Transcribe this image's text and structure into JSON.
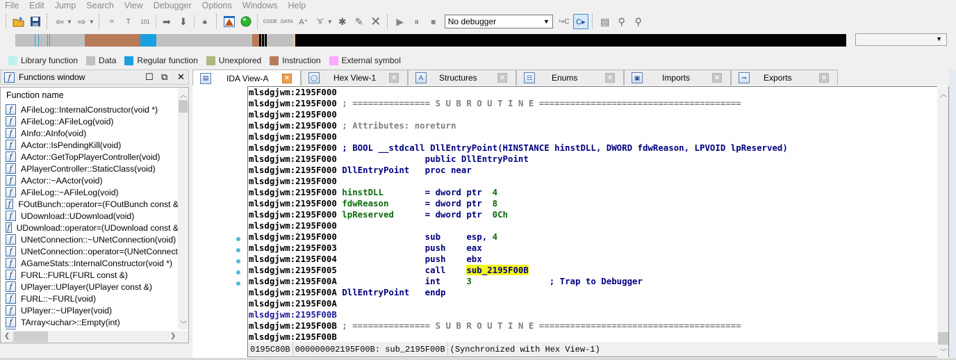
{
  "menubar": [
    "File",
    "Edit",
    "Jump",
    "Search",
    "View",
    "Debugger",
    "Options",
    "Windows",
    "Help"
  ],
  "toolbar": {
    "debugger_select": "No debugger",
    "icons": [
      "open-file-icon",
      "save-icon",
      "back-icon",
      "forward-icon",
      "search-binary-icon",
      "search-text-icon",
      "search-immediate-icon",
      "search-next-icon",
      "jump-icon",
      "lock-icon",
      "warning-icon",
      "green-ball-icon",
      "make-code-icon",
      "make-data-icon",
      "make-string-icon",
      "make-struct-icon",
      "make-function-icon",
      "edit-icon",
      "undefine-icon",
      "start-process-icon",
      "pause-icon",
      "stop-icon",
      "step-into-icon",
      "run-to-cursor-icon",
      "properties-icon",
      "add-breakpoint-icon",
      "remove-breakpoint-icon"
    ]
  },
  "navband": {
    "segments": [
      {
        "color": "#c0c0c0",
        "w": 28
      },
      {
        "color": "#3aa3d6",
        "w": 1
      },
      {
        "color": "#c0c0c0",
        "w": 4
      },
      {
        "color": "#3aa3d6",
        "w": 1
      },
      {
        "color": "#c0c0c0",
        "w": 12
      },
      {
        "color": "#b87b5a",
        "w": 1
      },
      {
        "color": "#c0c0c0",
        "w": 2
      },
      {
        "color": "#3aa3d6",
        "w": 1
      },
      {
        "color": "#c0c0c0",
        "w": 50
      },
      {
        "color": "#b87b5a",
        "w": 80
      },
      {
        "color": "#1aa0e0",
        "w": 23
      },
      {
        "color": "#c0c0c0",
        "w": 138
      },
      {
        "color": "#b87b5a",
        "w": 10
      },
      {
        "color": "#000000",
        "w": 3
      },
      {
        "color": "#c0c0c0",
        "w": 1
      },
      {
        "color": "#000000",
        "w": 3
      },
      {
        "color": "#c0c0c0",
        "w": 1
      },
      {
        "color": "#000000",
        "w": 3
      },
      {
        "color": "#c0c0c0",
        "w": 2
      },
      {
        "color": "#c0c0c0",
        "w": 36
      },
      {
        "color": "#e8c89a",
        "w": 3
      }
    ]
  },
  "legend": [
    {
      "label": "Library function",
      "color": "#bff0f0"
    },
    {
      "label": "Data",
      "color": "#c0c0c0"
    },
    {
      "label": "Regular function",
      "color": "#1aa0e0"
    },
    {
      "label": "Unexplored",
      "color": "#b2b87a"
    },
    {
      "label": "Instruction",
      "color": "#b87b5a"
    },
    {
      "label": "External symbol",
      "color": "#ffa8ff"
    }
  ],
  "functions_window": {
    "title": "Functions window",
    "column_header": "Function name",
    "items": [
      "AFileLog::InternalConstructor(void *)",
      "AFileLog::AFileLog(void)",
      "AInfo::AInfo(void)",
      "AActor::IsPendingKill(void)",
      "AActor::GetTopPlayerController(void)",
      "APlayerController::StaticClass(void)",
      "AActor::~AActor(void)",
      "AFileLog::~AFileLog(void)",
      "FOutBunch::operator=(FOutBunch const &",
      "UDownload::UDownload(void)",
      "UDownload::operator=(UDownload const &",
      "UNetConnection::~UNetConnection(void)",
      "UNetConnection::operator=(UNetConnect",
      "AGameStats::InternalConstructor(void *)",
      "FURL::FURL(FURL const &)",
      "UPlayer::UPlayer(UPlayer const &)",
      "FURL::~FURL(void)",
      "UPlayer::~UPlayer(void)",
      "TArray<uchar>::Empty(int)"
    ]
  },
  "tabs": [
    {
      "label": "IDA View-A",
      "icon": "ida-view-icon",
      "active": true
    },
    {
      "label": "Hex View-1",
      "icon": "hex-view-icon",
      "active": false
    },
    {
      "label": "Structures",
      "icon": "structures-icon",
      "active": false
    },
    {
      "label": "Enums",
      "icon": "enums-icon",
      "active": false
    },
    {
      "label": "Imports",
      "icon": "imports-icon",
      "active": false
    },
    {
      "label": "Exports",
      "icon": "exports-icon",
      "active": false
    }
  ],
  "listing": [
    {
      "addr": "mlsdgjwm:2195F000",
      "parts": []
    },
    {
      "addr": "mlsdgjwm:2195F000",
      "parts": [
        {
          "t": " ; =============== S U B R O U T I N E =======================================",
          "c": "cmt-gray"
        }
      ]
    },
    {
      "addr": "mlsdgjwm:2195F000",
      "parts": []
    },
    {
      "addr": "mlsdgjwm:2195F000",
      "parts": [
        {
          "t": " ; Attributes: noreturn",
          "c": "cmt-gray"
        }
      ]
    },
    {
      "addr": "mlsdgjwm:2195F000",
      "parts": []
    },
    {
      "addr": "mlsdgjwm:2195F000",
      "parts": [
        {
          "t": " ; BOOL __stdcall DllEntryPoint(HINSTANCE hinstDLL, DWORD fdwReason, LPVOID lpReserved)",
          "c": "blue"
        }
      ]
    },
    {
      "addr": "mlsdgjwm:2195F000",
      "parts": [
        {
          "t": "                 public DllEntryPoint",
          "c": "blue"
        }
      ]
    },
    {
      "addr": "mlsdgjwm:2195F000",
      "parts": [
        {
          "t": " DllEntryPoint   ",
          "c": "blue"
        },
        {
          "t": "proc near",
          "c": "blue"
        }
      ]
    },
    {
      "addr": "mlsdgjwm:2195F000",
      "parts": []
    },
    {
      "addr": "mlsdgjwm:2195F000",
      "parts": [
        {
          "t": " hinstDLL        ",
          "c": "green"
        },
        {
          "t": "= dword ptr  ",
          "c": "blue"
        },
        {
          "t": "4",
          "c": "green"
        }
      ]
    },
    {
      "addr": "mlsdgjwm:2195F000",
      "parts": [
        {
          "t": " fdwReason       ",
          "c": "green"
        },
        {
          "t": "= dword ptr  ",
          "c": "blue"
        },
        {
          "t": "8",
          "c": "green"
        }
      ]
    },
    {
      "addr": "mlsdgjwm:2195F000",
      "parts": [
        {
          "t": " lpReserved      ",
          "c": "green"
        },
        {
          "t": "= dword ptr  ",
          "c": "blue"
        },
        {
          "t": "0Ch",
          "c": "green"
        }
      ]
    },
    {
      "addr": "mlsdgjwm:2195F000",
      "parts": []
    },
    {
      "addr": "mlsdgjwm:2195F000",
      "bp": true,
      "parts": [
        {
          "t": "                 sub     esp, ",
          "c": "blue"
        },
        {
          "t": "4",
          "c": "green"
        }
      ]
    },
    {
      "addr": "mlsdgjwm:2195F003",
      "bp": true,
      "parts": [
        {
          "t": "                 push    eax",
          "c": "blue"
        }
      ]
    },
    {
      "addr": "mlsdgjwm:2195F004",
      "bp": true,
      "parts": [
        {
          "t": "                 push    ebx",
          "c": "blue"
        }
      ]
    },
    {
      "addr": "mlsdgjwm:2195F005",
      "bp": true,
      "parts": [
        {
          "t": "                 call    ",
          "c": "blue"
        },
        {
          "t": "sub_2195F00B",
          "c": "yellow"
        }
      ]
    },
    {
      "addr": "mlsdgjwm:2195F00A",
      "bp": true,
      "parts": [
        {
          "t": "                 int     ",
          "c": "blue"
        },
        {
          "t": "3",
          "c": "green"
        },
        {
          "t": "               ; Trap to Debugger",
          "c": "blue"
        }
      ]
    },
    {
      "addr": "mlsdgjwm:2195F00A",
      "parts": [
        {
          "t": " DllEntryPoint   endp",
          "c": "blue"
        }
      ]
    },
    {
      "addr": "mlsdgjwm:2195F00A",
      "parts": []
    },
    {
      "addr": "mlsdgjwm:2195F00B",
      "hl": true,
      "parts": []
    },
    {
      "addr": "mlsdgjwm:2195F00B",
      "parts": [
        {
          "t": " ; =============== S U B R O U T I N E =======================================",
          "c": "cmt-gray"
        }
      ]
    },
    {
      "addr": "mlsdgjwm:2195F00B",
      "parts": []
    }
  ],
  "status": {
    "offset": "0195C80B",
    "location": "000000002195F00B: sub_2195F00B",
    "sync": "(Synchronized with Hex View-1)"
  }
}
